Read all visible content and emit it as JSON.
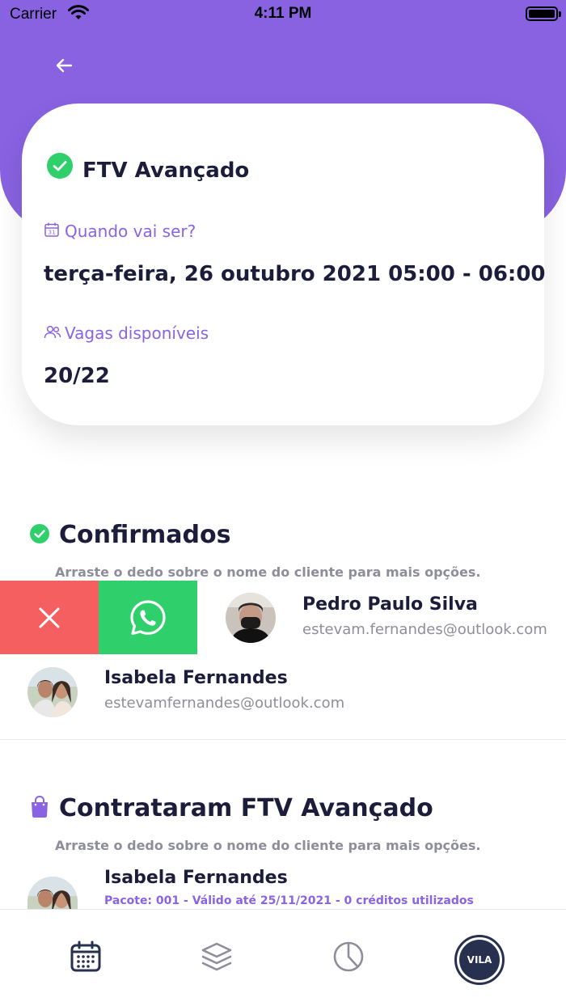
{
  "status_bar": {
    "carrier": "Carrier",
    "time": "4:11 PM"
  },
  "colors": {
    "header": "#8862e1",
    "accent": "#8a63e2",
    "success": "#2fcf6b",
    "danger": "#f55f5f",
    "text": "#1b1d3a",
    "muted": "#8e8e9a"
  },
  "class_card": {
    "title": "FTV Avançado",
    "when_label": "Quando vai ser?",
    "when_value": "terça-feira, 26 outubro 2021 05:00 - 06:00",
    "slots_label": "Vagas disponíveis",
    "slots_value": "20/22"
  },
  "confirmed": {
    "title": "Confirmados",
    "hint": "Arraste o dedo sobre o nome do cliente para mais opções.",
    "clients": [
      {
        "name": "Pedro Paulo Silva",
        "email": "estevam.fernandes@outlook.com"
      },
      {
        "name": "Isabela Fernandes",
        "email": "estevamfernandes@outlook.com"
      }
    ]
  },
  "contracted": {
    "title": "Contrataram FTV Avançado",
    "hint": "Arraste o dedo sobre o nome do cliente para mais opções.",
    "clients": [
      {
        "name": "Isabela Fernandes",
        "package": "Pacote: 001 - Válido até 25/11/2021 - 0 créditos utilizados"
      }
    ]
  },
  "tabs": [
    {
      "icon": "calendar-icon",
      "active": true
    },
    {
      "icon": "layers-icon",
      "active": false
    },
    {
      "icon": "pie-chart-icon",
      "active": false
    },
    {
      "icon": "club-logo",
      "logo_text": "VILA",
      "active": false
    }
  ]
}
